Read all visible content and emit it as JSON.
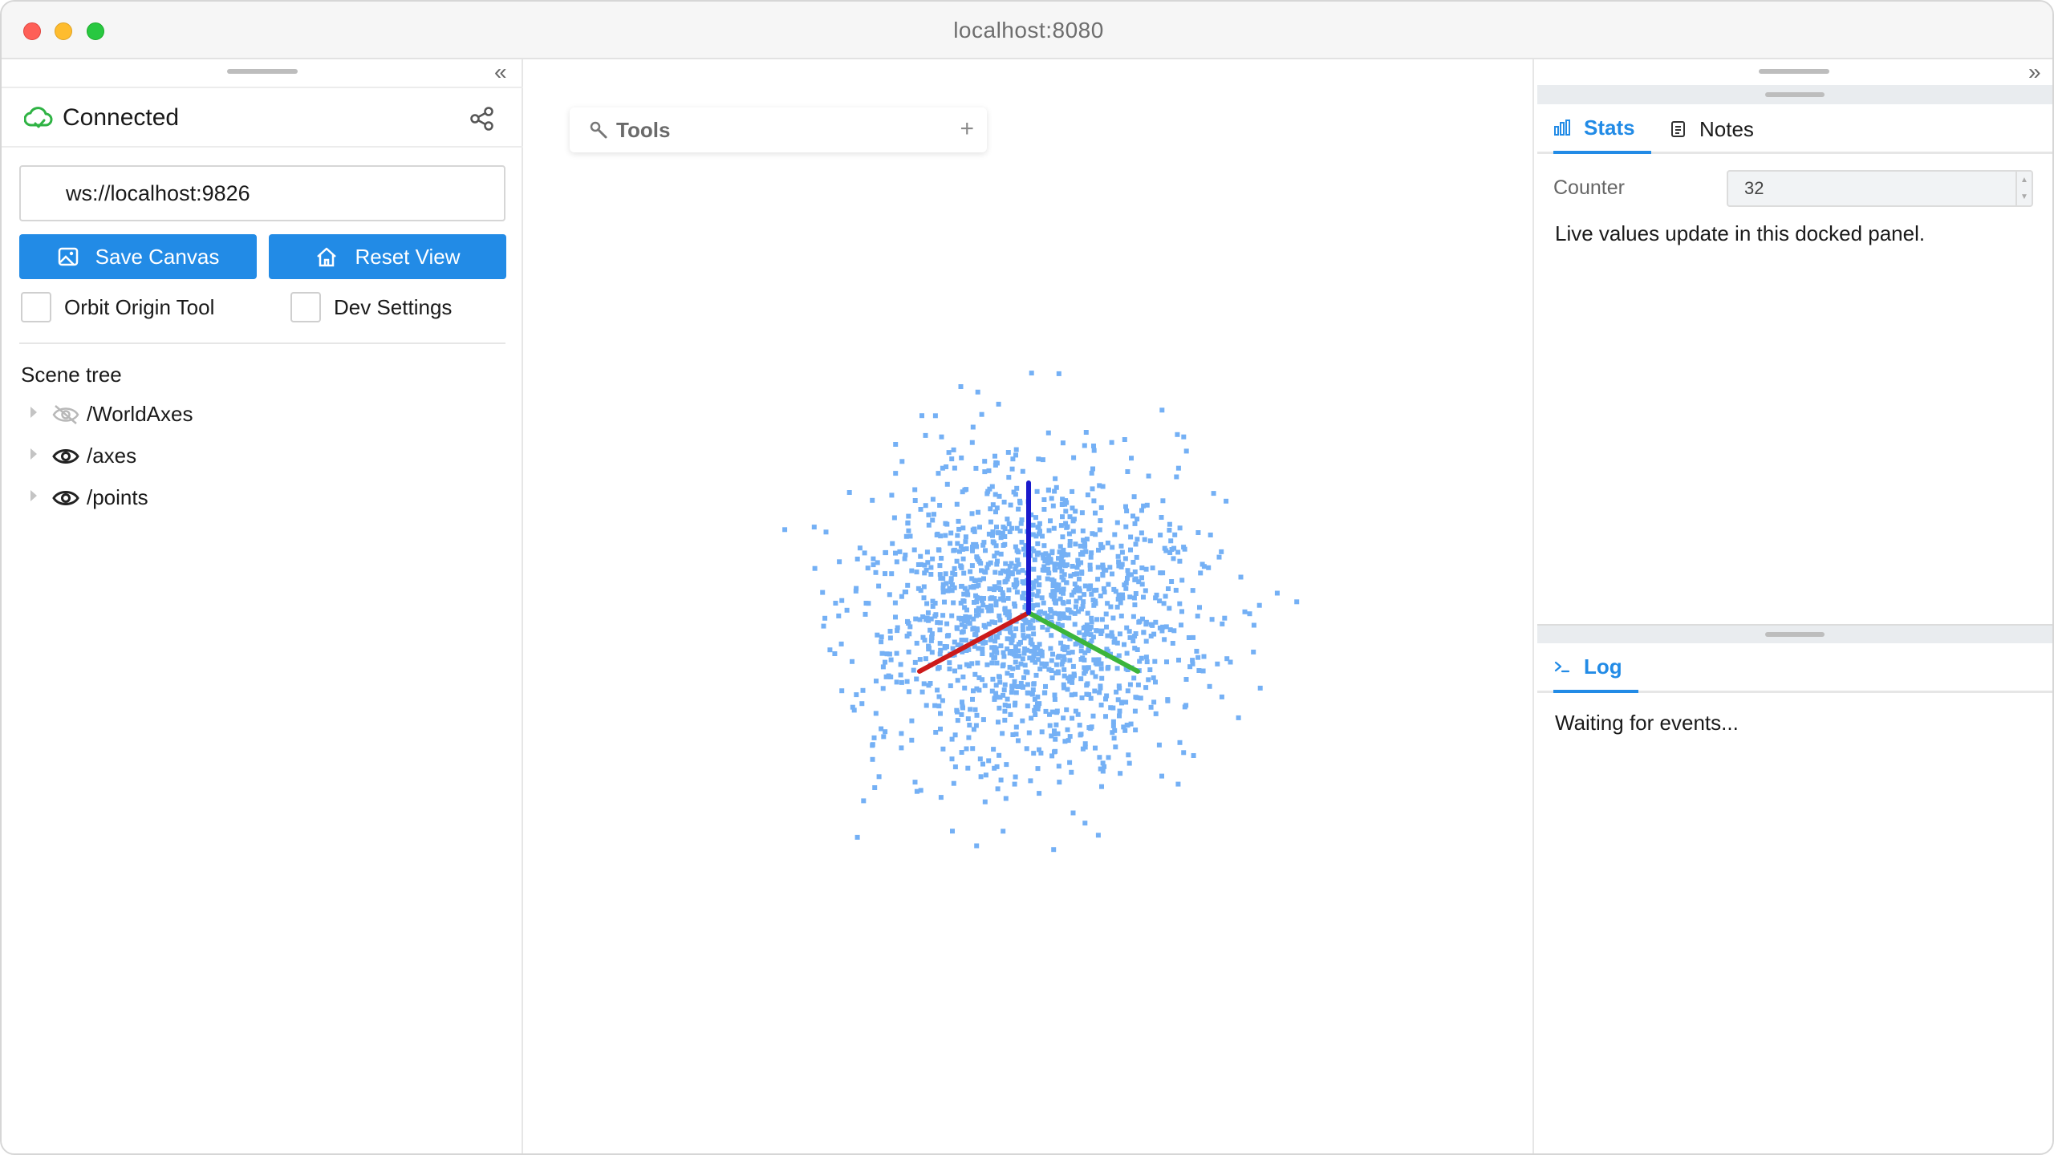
{
  "window": {
    "title": "localhost:8080"
  },
  "sidebar": {
    "connection": {
      "status": "Connected",
      "status_color": "#2fb344"
    },
    "server_url": "ws://localhost:9826",
    "buttons": {
      "save_canvas": "Save Canvas",
      "reset_view": "Reset View"
    },
    "checkboxes": {
      "orbit_origin_tool": "Orbit Origin Tool",
      "dev_settings": "Dev Settings"
    },
    "scene_tree": {
      "title": "Scene tree",
      "items": [
        {
          "label": "/WorldAxes",
          "icon": "eye-off-icon"
        },
        {
          "label": "/axes",
          "icon": "eye-icon"
        },
        {
          "label": "/points",
          "icon": "eye-icon"
        }
      ]
    }
  },
  "viewport": {
    "tools_label": "Tools",
    "tools_add": "+",
    "point_color": "#74b0f5",
    "axis_colors": {
      "x": "#cc1a1a",
      "y": "#3bb53b",
      "z": "#1a1acc"
    }
  },
  "right_panel": {
    "tabs": [
      {
        "label": "Stats",
        "icon": "bar-chart-icon",
        "active": true
      },
      {
        "label": "Notes",
        "icon": "notes-icon",
        "active": false
      }
    ],
    "counter_label": "Counter",
    "counter_value": "32",
    "stats_text": "Live values update in this docked panel.",
    "log_tab": {
      "label": "Log",
      "icon": "terminal-icon"
    },
    "log_text": "Waiting for events..."
  },
  "accent_color": "#228be6"
}
